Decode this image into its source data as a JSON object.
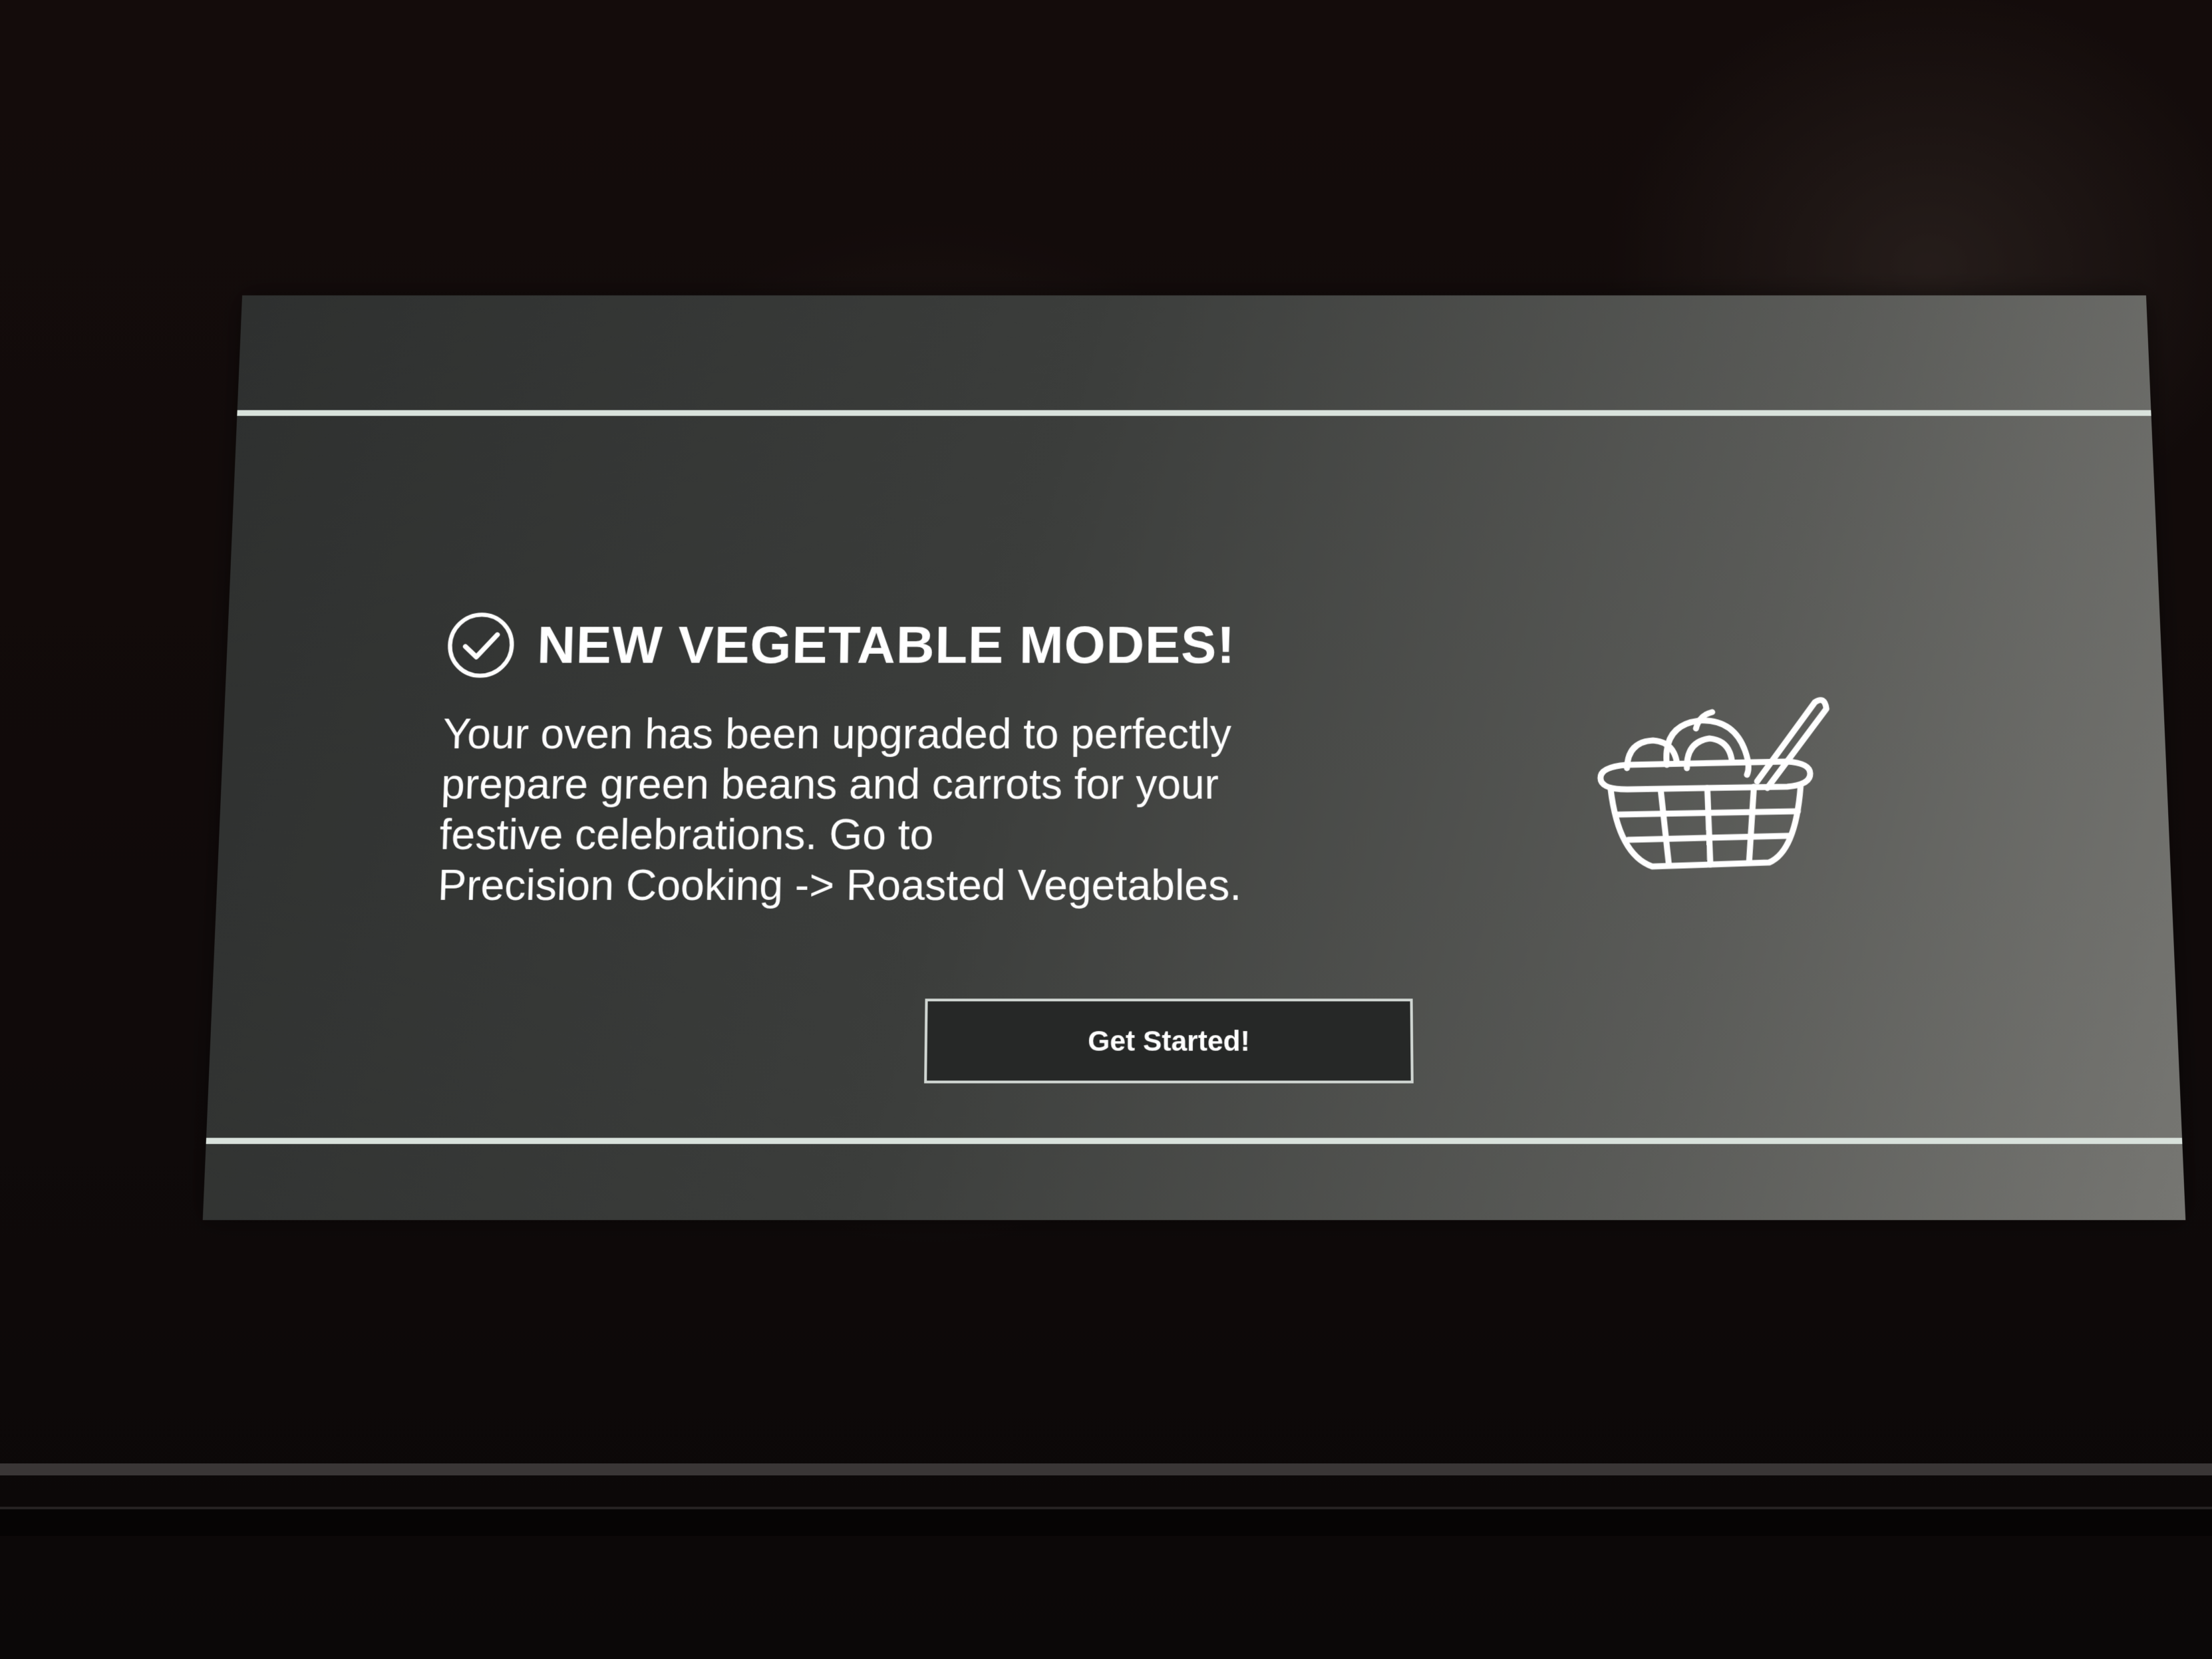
{
  "dialog": {
    "title": "NEW VEGETABLE MODES!",
    "status_icon": "check-circle-icon",
    "body_lines": [
      "Your oven has been upgraded to perfectly",
      "prepare green beans and carrots for your",
      "festive celebrations. Go to",
      "Precision Cooking -> Roasted Vegetables."
    ],
    "illustration_icon": "vegetable-basket-icon",
    "button_label": "Get Started!"
  },
  "colors": {
    "screen_background": "#3b3d3b",
    "divider_lines": "#d9e2dc",
    "text": "#ffffff",
    "button_border": "#d0d6d2"
  }
}
